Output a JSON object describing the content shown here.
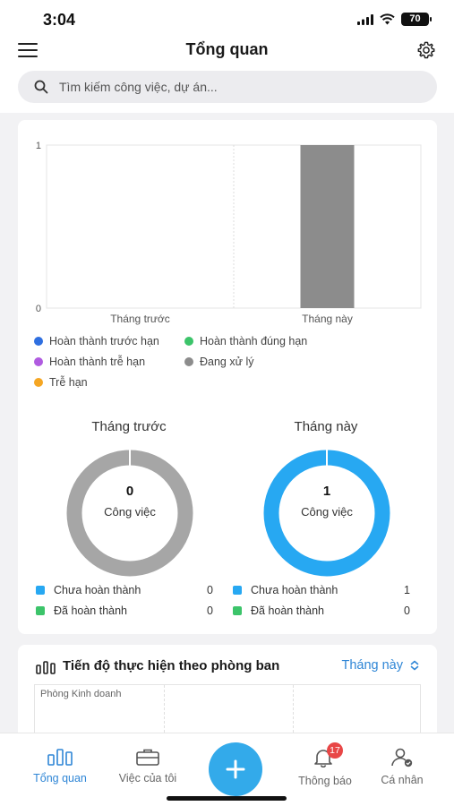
{
  "status_bar": {
    "time": "3:04",
    "battery": "70"
  },
  "header": {
    "title": "Tổng quan"
  },
  "search": {
    "placeholder": "Tìm kiếm công việc, dự án..."
  },
  "chart_data": [
    {
      "type": "bar",
      "categories": [
        "Tháng trước",
        "Tháng này"
      ],
      "series": [
        {
          "name": "Hoàn thành trước hạn",
          "color": "#2f6fe0",
          "values": [
            0,
            0
          ]
        },
        {
          "name": "Hoàn thành đúng hạn",
          "color": "#3cc46a",
          "values": [
            0,
            0
          ]
        },
        {
          "name": "Hoàn thành trễ hạn",
          "color": "#b05be0",
          "values": [
            0,
            0
          ]
        },
        {
          "name": "Đang xử lý",
          "color": "#8c8c8c",
          "values": [
            0,
            1
          ]
        },
        {
          "name": "Trễ hạn",
          "color": "#f5a623",
          "values": [
            0,
            0
          ]
        }
      ],
      "yticks": [
        "0",
        "1"
      ],
      "ylim": [
        0,
        1
      ],
      "grid": true,
      "legend": "bottom"
    },
    {
      "type": "pie",
      "title": "Tháng trước",
      "center_value": "0",
      "center_label": "Công việc",
      "slices": [
        {
          "label": "Chưa hoàn thành",
          "value": 0,
          "color": "#27a8f2"
        },
        {
          "label": "Đã hoàn thành",
          "value": 0,
          "color": "#3cc46a"
        }
      ],
      "empty_color": "#a6a6a6"
    },
    {
      "type": "pie",
      "title": "Tháng này",
      "center_value": "1",
      "center_label": "Công việc",
      "slices": [
        {
          "label": "Chưa hoàn thành",
          "value": 1,
          "color": "#27a8f2"
        },
        {
          "label": "Đã hoàn thành",
          "value": 0,
          "color": "#3cc46a"
        }
      ],
      "empty_color": "#a6a6a6"
    }
  ],
  "stats": {
    "prev": [
      {
        "label": "Chưa hoàn thành",
        "value": "0",
        "color": "#27a8f2"
      },
      {
        "label": "Đã hoàn thành",
        "value": "0",
        "color": "#3cc46a"
      }
    ],
    "curr": [
      {
        "label": "Chưa hoàn thành",
        "value": "1",
        "color": "#27a8f2"
      },
      {
        "label": "Đã hoàn thành",
        "value": "0",
        "color": "#3cc46a"
      }
    ]
  },
  "progress": {
    "title": "Tiến độ thực hiện theo phòng ban",
    "filter": "Tháng này",
    "department": "Phòng Kinh doanh"
  },
  "nav": {
    "items": [
      {
        "label": "Tổng quan",
        "icon": "chart-bars-icon"
      },
      {
        "label": "Việc của tôi",
        "icon": "briefcase-icon"
      },
      {
        "label": "Thông báo",
        "icon": "bell-icon",
        "badge": "17"
      },
      {
        "label": "Cá nhân",
        "icon": "user-icon"
      }
    ],
    "fab_icon": "plus-icon"
  },
  "colors": {
    "accent": "#2f86d6",
    "fab": "#33aaea"
  }
}
